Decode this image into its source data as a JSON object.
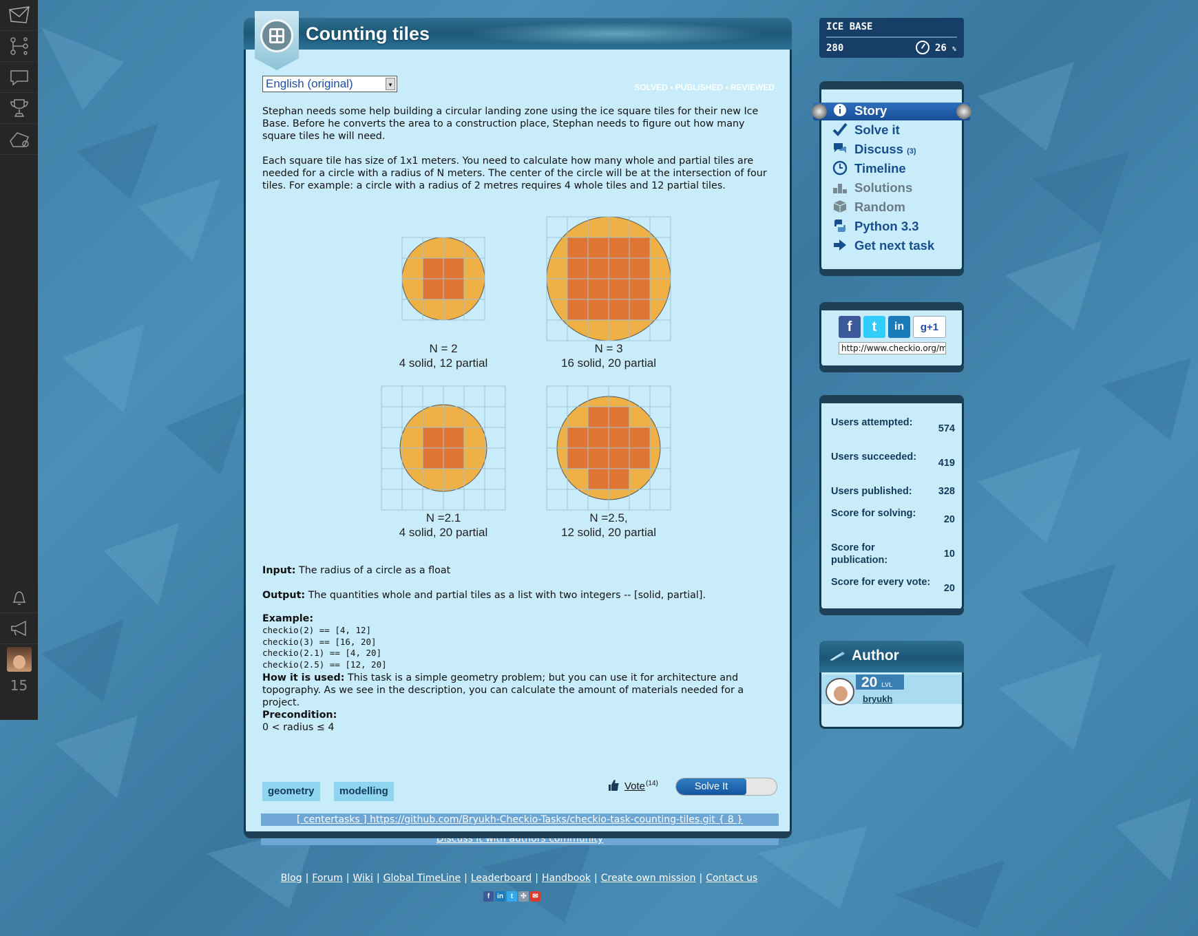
{
  "sidebar": {
    "icons": [
      "envelope-logo-icon",
      "tree-icon",
      "chat-bubble-icon",
      "trophy-icon",
      "island-icon"
    ],
    "bottom_icons": [
      "bell-icon",
      "megaphone-icon"
    ],
    "count": "15"
  },
  "task": {
    "title": "Counting tiles",
    "language": "English (original)",
    "status": "SOLVED • PUBLISHED • REVIEWED",
    "paragraph1": "Stephan needs some help building a circular landing zone using the ice square tiles for their new Ice Base. Before he converts the area to a construction place, Stephan needs to figure out how many square tiles he will need.",
    "paragraph2": "Each square tile has size of 1x1 meters. You need to calculate how many whole and partial tiles are needed for a circle with a radius of N meters. The center of the circle will be at the intersection of four tiles. For example: a circle with a radius of 2 metres requires 4 whole tiles and 12 partial tiles.",
    "figures": [
      {
        "n": "N = 2",
        "desc": "4 solid, 12 partial"
      },
      {
        "n": "N = 3",
        "desc": "16 solid, 20 partial"
      },
      {
        "n": "N =2.1",
        "desc": "4 solid, 20 partial"
      },
      {
        "n": "N =2.5,",
        "desc": "12 solid, 20 partial"
      }
    ],
    "input_label": "Input:",
    "input_text": "The radius of a circle as a float",
    "output_label": "Output:",
    "output_text": "The quantities whole and partial tiles as a list with two integers -- [solid, partial].",
    "example_label": "Example:",
    "examples": [
      "checkio(2) == [4, 12]",
      "checkio(3) == [16, 20]",
      "checkio(2.1) == [4, 20]",
      "checkio(2.5) == [12, 20]"
    ],
    "used_label": "How it is used:",
    "used_text": "This task is a simple geometry problem; but you can use it for architecture and topography. As we see in the description, you can calculate the amount of materials needed for a project.",
    "precondition_label": "Precondition:",
    "precondition_text": "0 < radius ≤ 4",
    "tags": [
      "geometry",
      "modelling"
    ],
    "vote_label": "Vote",
    "vote_count": "(14)",
    "solve_label": "Solve It",
    "repo_link": "[ centertasks ] https://github.com/Bryukh-Checkio-Tasks/checkio-task-counting-tiles.git { 8 }",
    "discuss_link": "Discuss it with authors community"
  },
  "icebase": {
    "title": "ICE BASE",
    "points": "280",
    "percent": "26",
    "percent_unit": "%"
  },
  "menu": {
    "items": [
      {
        "label": "Story",
        "icon": "info-icon",
        "active": true
      },
      {
        "label": "Solve it",
        "icon": "checkmark-icon"
      },
      {
        "label": "Discuss",
        "icon": "discuss-icon",
        "count": "(3)"
      },
      {
        "label": "Timeline",
        "icon": "clock-icon"
      },
      {
        "label": "Solutions",
        "icon": "podium-icon"
      },
      {
        "label": "Random",
        "icon": "dice-icon"
      },
      {
        "label": "Python 3.3",
        "icon": "python-icon"
      },
      {
        "label": "Get next task",
        "icon": "arrow-right-icon"
      }
    ]
  },
  "social": {
    "buttons": [
      "f",
      "t",
      "in",
      "g+1"
    ],
    "share_url": "http://www.checkio.org/mission/counting-tiles/"
  },
  "stats": [
    {
      "label": "Users attempted:",
      "value": "574"
    },
    {
      "label": "Users succeeded:",
      "value": "419"
    },
    {
      "label": "Users published:",
      "value": "328"
    },
    {
      "label": "Score for solving:",
      "value": "20"
    },
    {
      "label": "Score for publication:",
      "value": "10"
    },
    {
      "label": "Score for every vote:",
      "value": "20"
    }
  ],
  "author": {
    "title": "Author",
    "level": "20",
    "level_unit": "LVL",
    "name": "bryukh"
  },
  "footer": {
    "links": [
      "Blog",
      "Forum",
      "Wiki",
      "Global TimeLine",
      "Leaderboard",
      "Handbook",
      "Create own mission",
      "Contact us"
    ],
    "separator": "|",
    "icons": [
      "facebook-icon",
      "linkedin-icon",
      "twitter-icon",
      "googleplus-icon",
      "gmail-icon"
    ]
  },
  "colors": {
    "circle": "#efb145",
    "solid_tile": "#e07432",
    "grid": "#9fc3d6",
    "panel_bg": "#c9ecfa",
    "menu_text": "#174f8e"
  }
}
